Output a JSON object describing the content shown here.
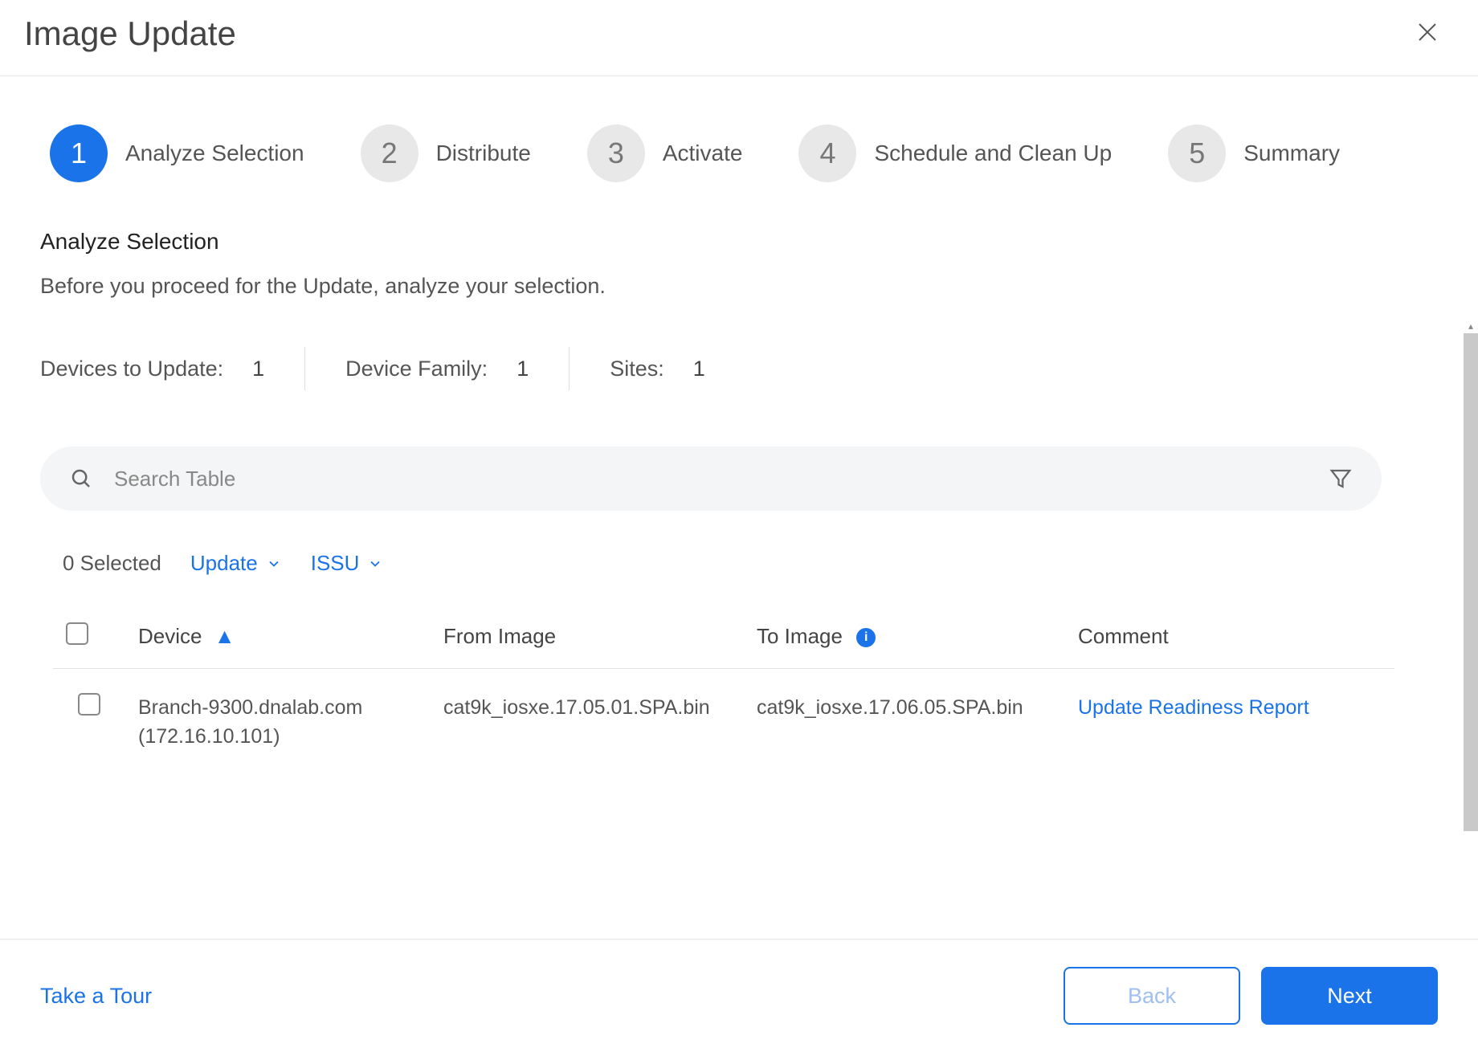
{
  "header": {
    "title": "Image Update"
  },
  "stepper": {
    "steps": [
      {
        "num": "1",
        "label": "Analyze Selection",
        "active": true
      },
      {
        "num": "2",
        "label": "Distribute",
        "active": false
      },
      {
        "num": "3",
        "label": "Activate",
        "active": false
      },
      {
        "num": "4",
        "label": "Schedule and Clean Up",
        "active": false
      },
      {
        "num": "5",
        "label": "Summary",
        "active": false
      }
    ]
  },
  "section": {
    "title": "Analyze Selection",
    "description": "Before you proceed for the Update, analyze your selection."
  },
  "summary": {
    "devices_label": "Devices to Update:",
    "devices_value": "1",
    "family_label": "Device Family:",
    "family_value": "1",
    "sites_label": "Sites:",
    "sites_value": "1"
  },
  "search": {
    "placeholder": "Search Table"
  },
  "toolbar": {
    "selected_text": "0 Selected",
    "update_label": "Update",
    "issu_label": "ISSU"
  },
  "table": {
    "headers": {
      "device": "Device",
      "from": "From Image",
      "to": "To Image",
      "comment": "Comment"
    },
    "rows": [
      {
        "device": "Branch-9300.dnalab.com (172.16.10.101)",
        "from": "cat9k_iosxe.17.05.01.SPA.bin",
        "to": "cat9k_iosxe.17.06.05.SPA.bin",
        "comment": "Update Readiness Report"
      }
    ]
  },
  "footer": {
    "tour": "Take a Tour",
    "back": "Back",
    "next": "Next"
  }
}
